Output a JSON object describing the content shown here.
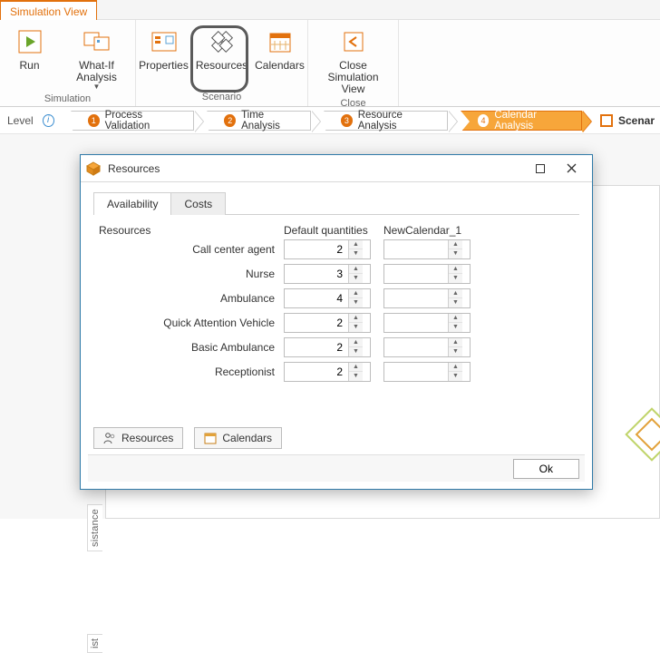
{
  "tab": "Simulation View",
  "ribbon": {
    "run": "Run",
    "whatif": "What-If Analysis",
    "properties": "Properties",
    "resources": "Resources",
    "calendars": "Calendars",
    "close": "Close Simulation View",
    "group_sim": "Simulation",
    "group_scen": "Scenario",
    "group_close": "Close"
  },
  "level": {
    "label": "Level",
    "steps": [
      {
        "n": "1",
        "t": "Process Validation"
      },
      {
        "n": "2",
        "t": "Time Analysis"
      },
      {
        "n": "3",
        "t": "Resource Analysis"
      },
      {
        "n": "4",
        "t": "Calendar Analysis"
      }
    ],
    "scenario_btn": "Scenar"
  },
  "side1": "sistance",
  "side2": "ist",
  "dialog": {
    "title": "Resources",
    "tab_avail": "Availability",
    "tab_costs": "Costs",
    "col_res": "Resources",
    "col_def": "Default quantities",
    "col_cal": "NewCalendar_1",
    "rows": [
      {
        "name": "Call center agent",
        "v": "2"
      },
      {
        "name": "Nurse",
        "v": "3"
      },
      {
        "name": "Ambulance",
        "v": "4"
      },
      {
        "name": "Quick Attention Vehicle",
        "v": "2"
      },
      {
        "name": "Basic Ambulance",
        "v": "2"
      },
      {
        "name": "Receptionist",
        "v": "2"
      }
    ],
    "btn_res": "Resources",
    "btn_cal": "Calendars",
    "ok": "Ok"
  }
}
